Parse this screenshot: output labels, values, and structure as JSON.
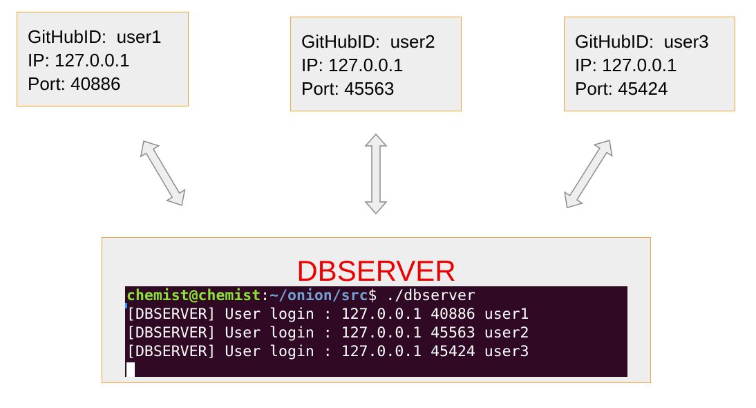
{
  "users": [
    {
      "github_line": "GitHubID:  user1",
      "ip_line": "IP: 127.0.0.1",
      "port_line": "Port: 40886"
    },
    {
      "github_line": "GitHubID:  user2",
      "ip_line": "IP: 127.0.0.1",
      "port_line": "Port: 45563"
    },
    {
      "github_line": "GitHubID:  user3",
      "ip_line": "IP: 127.0.0.1",
      "port_line": "Port: 45424"
    }
  ],
  "server": {
    "title": "DBSERVER",
    "title_color": "#ee0000"
  },
  "terminal": {
    "prompt_user": "chemist@chemist",
    "prompt_sep": ":",
    "prompt_path": "~/onion/src",
    "prompt_cmd": "$ ./dbserver",
    "lines": [
      "[DBSERVER] User login : 127.0.0.1 40886 user1",
      "[DBSERVER] User login : 127.0.0.1 45563 user2",
      "[DBSERVER] User login : 127.0.0.1 45424 user3"
    ],
    "background": "#300a24"
  },
  "colors": {
    "box_border": "#f4a43a",
    "box_fill": "#eeeeee",
    "arrow_fill": "#eeeeee",
    "arrow_stroke": "#8c8c8c"
  }
}
